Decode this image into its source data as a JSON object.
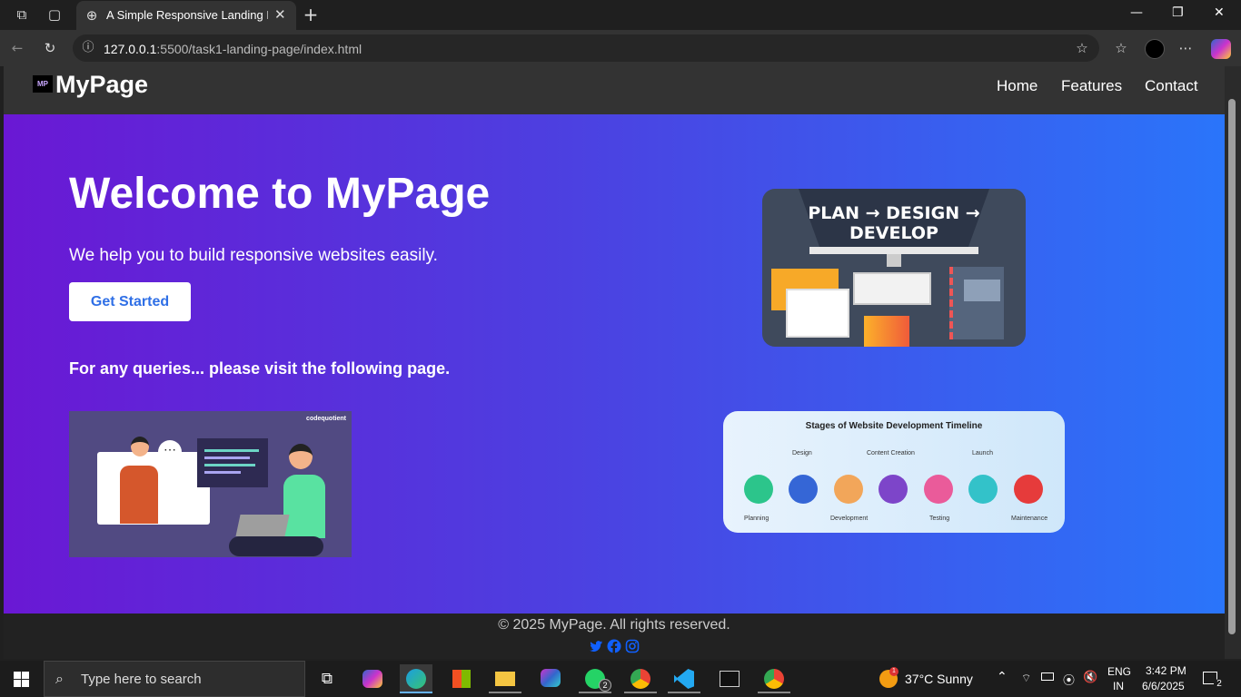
{
  "browser": {
    "tab_title": "A Simple Responsive Landing Page",
    "url_host": "127.0.0.1",
    "url_path": ":5500/task1-landing-page/index.html"
  },
  "nav": {
    "logo_mark": "MP",
    "logo": "MyPage",
    "links": [
      "Home",
      "Features",
      "Contact"
    ]
  },
  "hero": {
    "title": "Welcome to MyPage",
    "subtitle": "We help you to build responsive websites easily.",
    "button": "Get Started",
    "query_text": "For any queries... please visit the following page."
  },
  "images": {
    "plan_banner": "PLAN → DESIGN → DEVELOP",
    "timeline_title": "Stages of Website Development Timeline",
    "timeline_top": [
      "Design",
      "Content Creation",
      "Launch"
    ],
    "timeline_bottom": [
      "Planning",
      "Development",
      "Testing",
      "Maintenance"
    ],
    "brand": "codequotient"
  },
  "footer": {
    "copyright": "© 2025 MyPage. All rights reserved."
  },
  "taskbar": {
    "search_placeholder": "Type here to search",
    "weather": "37°C  Sunny",
    "lang": "ENG",
    "region": "IN",
    "time": "3:42 PM",
    "date": "6/6/2025",
    "notif_count": "2",
    "whatsapp_badge": "2",
    "weather_badge": "1"
  },
  "colors": {
    "gradient_start": "#6a18d4",
    "gradient_end": "#2a75fa",
    "nav_bg": "#333333",
    "button_text": "#2f6fe6"
  }
}
